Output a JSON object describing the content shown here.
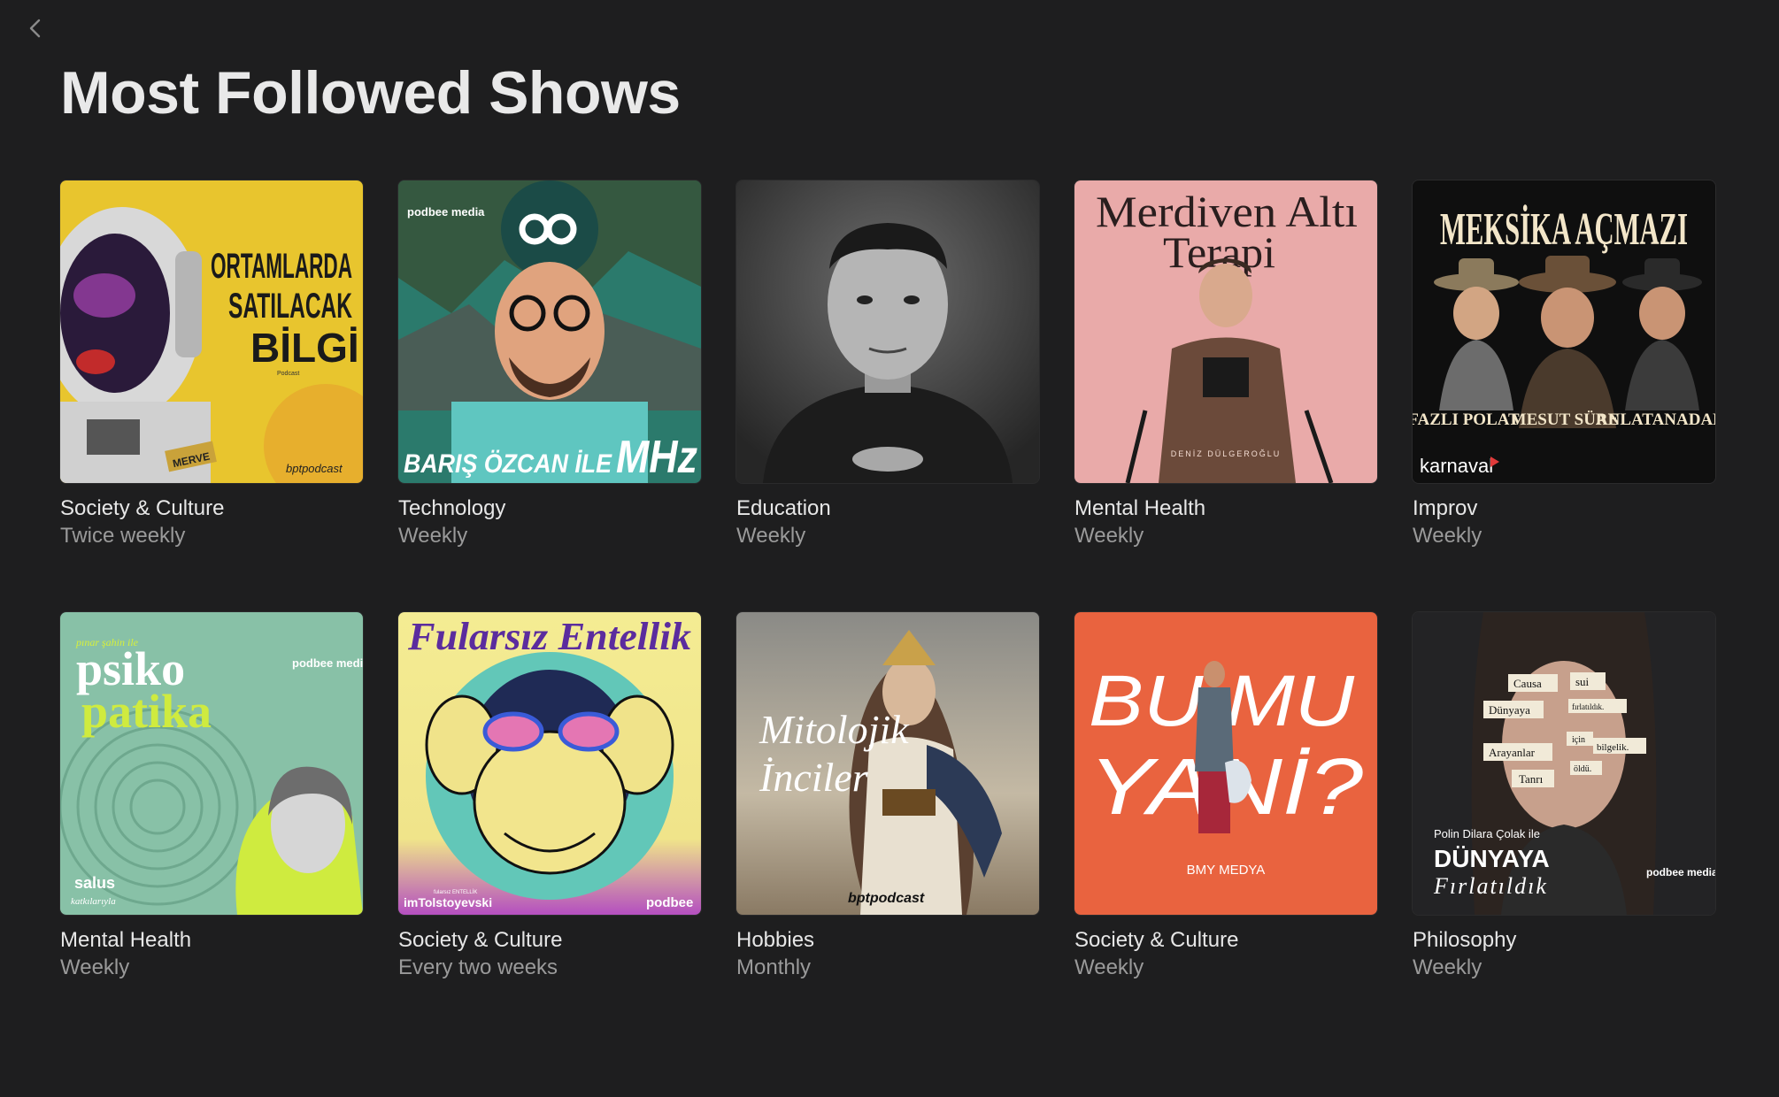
{
  "header": {
    "back_icon": "chevron-left-icon",
    "title": "Most Followed Shows"
  },
  "shows": [
    {
      "genre": "Society & Culture",
      "frequency": "Twice weekly",
      "art": {
        "title": "ORTAMLARDA SATILACAK BİLGİ",
        "brand": "bptpodcast",
        "badge": "MERVE",
        "small": "Podcast",
        "bg": "#e8c52e"
      }
    },
    {
      "genre": "Technology",
      "frequency": "Weekly",
      "art": {
        "title": "BARIŞ ÖZCAN İLE",
        "suffix": "MHz",
        "brand": "podbee media",
        "bg": "#2bb3a6"
      }
    },
    {
      "genre": "Education",
      "frequency": "Weekly",
      "art": {
        "bg": "#3a3a3a"
      }
    },
    {
      "genre": "Mental Health",
      "frequency": "Weekly",
      "art": {
        "title": "Merdiven Altı Terapi",
        "host": "DENİZ DÜLGEROĞLU",
        "bg": "#e7a8ab"
      }
    },
    {
      "genre": "Improv",
      "frequency": "Weekly",
      "art": {
        "title": "MEKSİKA AÇMAZI",
        "names": [
          "FAZLI POLAT",
          "MESUT SÜRE",
          "ANLATANADAM"
        ],
        "brand": "karnaval",
        "bg": "#111111"
      }
    },
    {
      "genre": "Mental Health",
      "frequency": "Weekly",
      "art": {
        "kicker": "pınar şahin ile",
        "title1": "psiko",
        "title2": "patika",
        "brand": "podbee media",
        "sponsor": "salus",
        "sponsor_sub": "katkılarıyla",
        "bg": "#86c0a8"
      }
    },
    {
      "genre": "Society & Culture",
      "frequency": "Every two weeks",
      "art": {
        "title": "Fularsız Entellik",
        "handle": "imTolstoyevski",
        "handle_top": "fularsız ENTELLİK",
        "brand": "podbee",
        "bg": "#f2ea8c"
      }
    },
    {
      "genre": "Hobbies",
      "frequency": "Monthly",
      "art": {
        "title1": "Mitolojik",
        "title2": "İnciler",
        "brand": "bptpodcast",
        "bg": "#b9ad9a"
      }
    },
    {
      "genre": "Society & Culture",
      "frequency": "Weekly",
      "art": {
        "title1": "BU MU",
        "title2": "YANİ?",
        "brand": "BMY MEDYA",
        "bg": "#e8603f"
      }
    },
    {
      "genre": "Philosophy",
      "frequency": "Weekly",
      "art": {
        "words": [
          "Causa",
          "sui",
          "Dünyaya",
          "fırlatıldık.",
          "için",
          "Arayanlar",
          "bilgelik.",
          "öldü.",
          "Tanrı"
        ],
        "host": "Polin Dilara Çolak ile",
        "title1": "DÜNYAYA",
        "title2": "Fırlatıldık",
        "brand": "podbee media",
        "bg": "#232325"
      }
    }
  ]
}
